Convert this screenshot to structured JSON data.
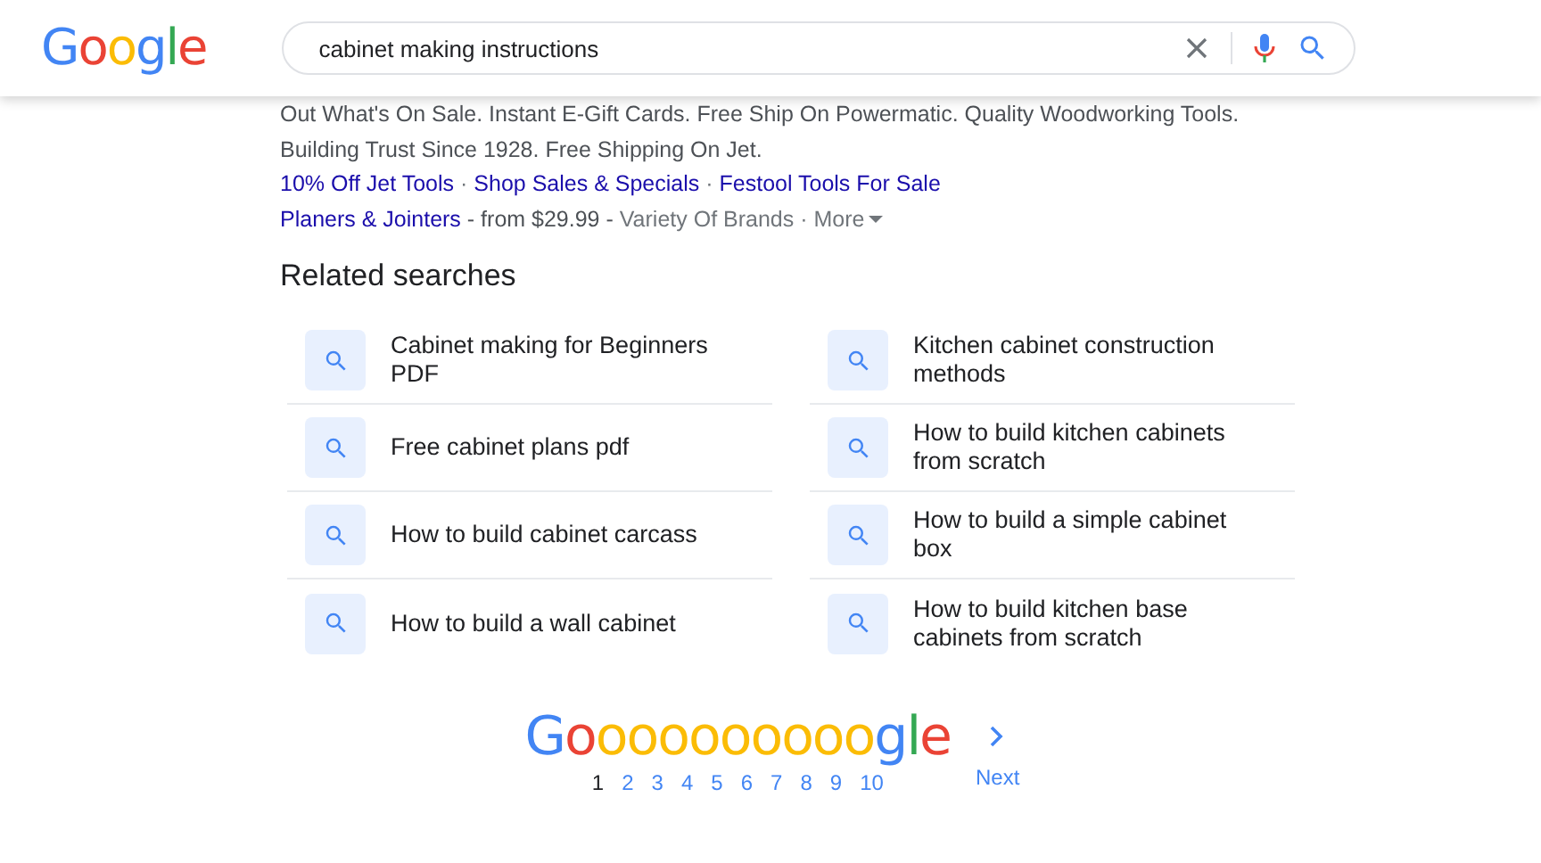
{
  "header": {
    "logo": [
      {
        "char": "G",
        "color": "#4285f4"
      },
      {
        "char": "o",
        "color": "#ea4335"
      },
      {
        "char": "o",
        "color": "#fbbc05"
      },
      {
        "char": "g",
        "color": "#4285f4"
      },
      {
        "char": "l",
        "color": "#34a853"
      },
      {
        "char": "e",
        "color": "#ea4335"
      }
    ],
    "search": {
      "value": "cabinet making instructions"
    }
  },
  "ad": {
    "lines": [
      "Out What's On Sale. Instant E-Gift Cards. Free Ship On Powermatic. Quality Woodworking Tools.",
      "Building Trust Since 1928. Free Shipping On Jet."
    ],
    "sitelinks": [
      "10% Off Jet Tools",
      "Shop Sales & Specials",
      "Festool Tools For Sale"
    ],
    "separator": "·",
    "extension": {
      "link": "Planers & Jointers",
      "price": "- from $29.99 -",
      "note": "Variety Of Brands",
      "more": "More"
    }
  },
  "related": {
    "title": "Related searches",
    "items": [
      {
        "text": "Cabinet making for Beginners PDF"
      },
      {
        "text": "Kitchen cabinet construction methods"
      },
      {
        "text": "Free cabinet plans pdf"
      },
      {
        "text": "How to build kitchen cabinets from scratch"
      },
      {
        "text": "How to build cabinet carcass"
      },
      {
        "text": "How to build a simple cabinet box"
      },
      {
        "text": "How to build a wall cabinet"
      },
      {
        "text": "How to build kitchen base cabinets from scratch"
      }
    ]
  },
  "pagination": {
    "logo": [
      {
        "char": "G",
        "color": "#4285f4"
      },
      {
        "char": "o",
        "color": "#ea4335"
      },
      {
        "char": "o",
        "color": "#fbbc05"
      },
      {
        "char": "o",
        "color": "#fbbc05"
      },
      {
        "char": "o",
        "color": "#fbbc05"
      },
      {
        "char": "o",
        "color": "#fbbc05"
      },
      {
        "char": "o",
        "color": "#fbbc05"
      },
      {
        "char": "o",
        "color": "#fbbc05"
      },
      {
        "char": "o",
        "color": "#fbbc05"
      },
      {
        "char": "o",
        "color": "#fbbc05"
      },
      {
        "char": "o",
        "color": "#fbbc05"
      },
      {
        "char": "g",
        "color": "#4285f4"
      },
      {
        "char": "l",
        "color": "#34a853"
      },
      {
        "char": "e",
        "color": "#ea4335"
      }
    ],
    "pages": [
      {
        "label": "1",
        "selected": true
      },
      {
        "label": "2",
        "selected": false
      },
      {
        "label": "3",
        "selected": false
      },
      {
        "label": "4",
        "selected": false
      },
      {
        "label": "5",
        "selected": false
      },
      {
        "label": "6",
        "selected": false
      },
      {
        "label": "7",
        "selected": false
      },
      {
        "label": "8",
        "selected": false
      },
      {
        "label": "9",
        "selected": false
      },
      {
        "label": "10",
        "selected": false
      }
    ],
    "next": "Next"
  }
}
